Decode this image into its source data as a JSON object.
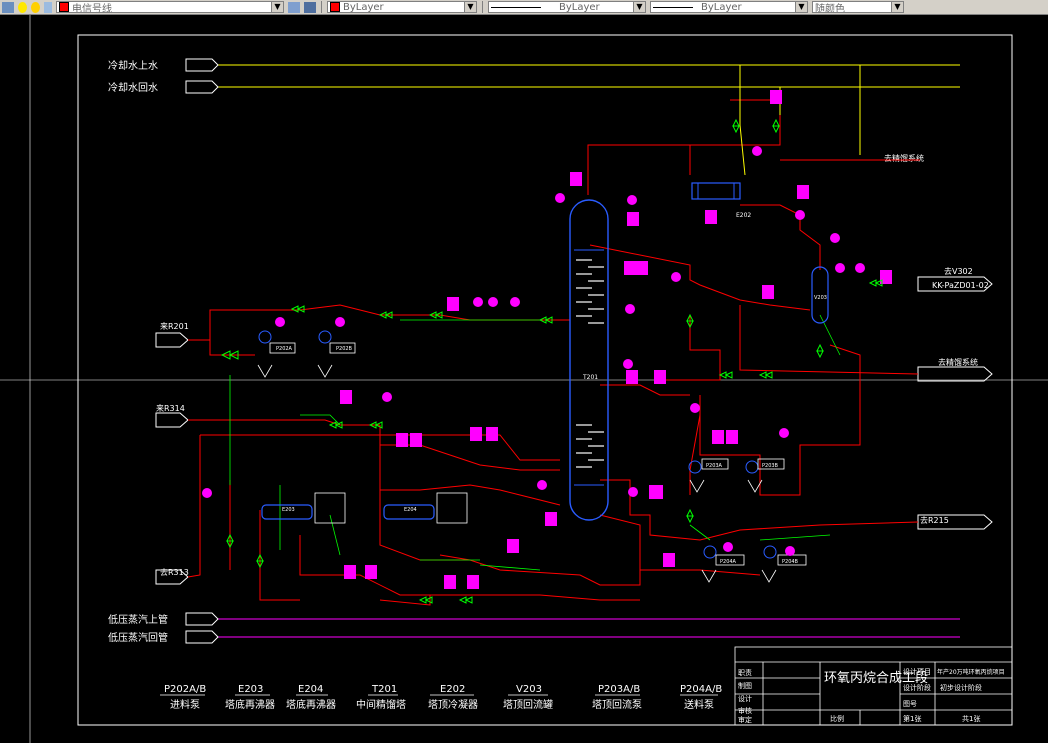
{
  "toolbar": {
    "layer_name": "电信号线",
    "color": "ByLayer",
    "linetype": "ByLayer",
    "lineweight": "ByLayer",
    "plotstyle": "随颜色",
    "layer_color": "#ff0000",
    "bylayer_color": "#ff0000"
  },
  "drawing": {
    "utility_labels": [
      "冷却水上水",
      "冷却水回水",
      "低压蒸汽上管",
      "低压蒸汽回管"
    ],
    "offpage": {
      "from_r201": "来R201",
      "from_r314": "来R314",
      "to_r313": "去R313",
      "to_r215": "去R215",
      "to_v302": "去V302",
      "line_ref": "KK-PaZD01-02",
      "vent1": "去精馏系统",
      "vent2": "去精馏系统"
    },
    "column_tag": "T201",
    "reboiler_tags": [
      "E203",
      "E204"
    ],
    "condenser_tag": "E202",
    "drum_tag": "V203",
    "pump_tags": [
      "P202A",
      "P202B",
      "P203A",
      "P203B",
      "P204A",
      "P204B"
    ],
    "legend": [
      {
        "tag": "P202A/B",
        "name": "进料泵"
      },
      {
        "tag": "E203",
        "name": "塔底再沸器"
      },
      {
        "tag": "E204",
        "name": "塔底再沸器"
      },
      {
        "tag": "T201",
        "name": "中间精馏塔"
      },
      {
        "tag": "E202",
        "name": "塔顶冷凝器"
      },
      {
        "tag": "V203",
        "name": "塔顶回流罐"
      },
      {
        "tag": "P203A/B",
        "name": "塔顶回流泵"
      },
      {
        "tag": "P204A/B",
        "name": "送料泵"
      }
    ],
    "title_block": {
      "rows_left": [
        "职责",
        "制图",
        "设计",
        "审核",
        "审定"
      ],
      "title": "环氧丙烷合成工段",
      "scale_label": "比例",
      "project_label": "设计项目",
      "project_value": "年产20万吨环氧丙烷项目",
      "stage_label": "设计阶段",
      "stage_value": "初步设计阶段",
      "drawing_no_label": "图号",
      "sheet": "第1张",
      "total": "共1张"
    }
  },
  "colors": {
    "pipe_red": "#ff0000",
    "utility_yellow": "#ffff00",
    "steam_magenta": "#ff00ff",
    "equipment_blue": "#2a5cff",
    "valve_green": "#00ff00",
    "instrument_magenta": "#ff00ff",
    "frame_white": "#ffffff"
  }
}
